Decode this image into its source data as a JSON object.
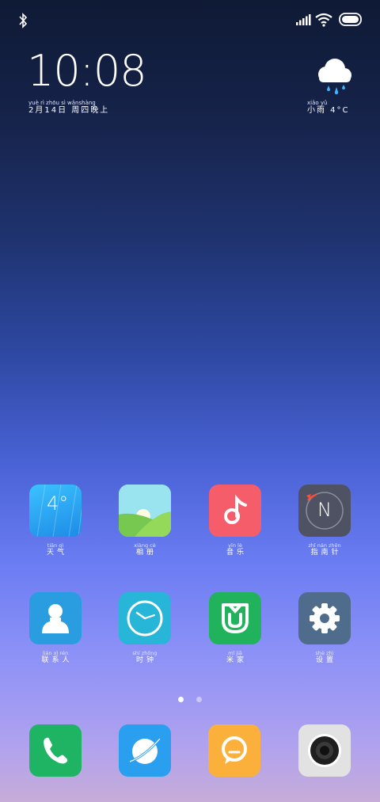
{
  "clock": {
    "time": "10:08"
  },
  "date": {
    "pinyin": "yuè   rì  zhōu  sì  wǎnshàng",
    "text": "2月14日 周四晚上"
  },
  "weather": {
    "pinyin": "xiǎo  yǔ",
    "text": "小雨 4°C",
    "icon": "rain-cloud"
  },
  "status": {
    "battery": "full",
    "icons": [
      "bluetooth-icon",
      "signal-icon",
      "wifi-icon",
      "battery-icon"
    ]
  },
  "apps": [
    {
      "id": "weather",
      "pinyin": "tiān  qì",
      "label": "天气",
      "tile_text": "4°",
      "color": "#2d9ef0"
    },
    {
      "id": "gallery",
      "pinyin": "xiàng  cè",
      "label": "相册",
      "color": "#8fd46a"
    },
    {
      "id": "music",
      "pinyin": "yīn  lè",
      "label": "音乐",
      "color": "#f4606c"
    },
    {
      "id": "compass",
      "pinyin": "zhǐ  nán  zhēn",
      "label": "指南针",
      "tile_text": "N",
      "color": "#505566"
    },
    {
      "id": "contacts",
      "pinyin": "lián  xì  rén",
      "label": "联系人",
      "color": "#2a9de0"
    },
    {
      "id": "clock",
      "pinyin": "shí  zhōng",
      "label": "时钟",
      "color": "#27b5d8"
    },
    {
      "id": "mijia",
      "pinyin": "mǐ  jiā",
      "label": "米家",
      "color": "#21b35c"
    },
    {
      "id": "settings",
      "pinyin": "shè  zhì",
      "label": "设置",
      "color": "#4f6c8c"
    }
  ],
  "dock": [
    {
      "id": "phone",
      "color": "#1fb463"
    },
    {
      "id": "browser",
      "color": "#2a9ff0"
    },
    {
      "id": "messages",
      "color": "#fbb03b"
    },
    {
      "id": "camera",
      "color": "#e2e2e2"
    }
  ],
  "page_indicator": {
    "pages": 2,
    "current": 1
  }
}
